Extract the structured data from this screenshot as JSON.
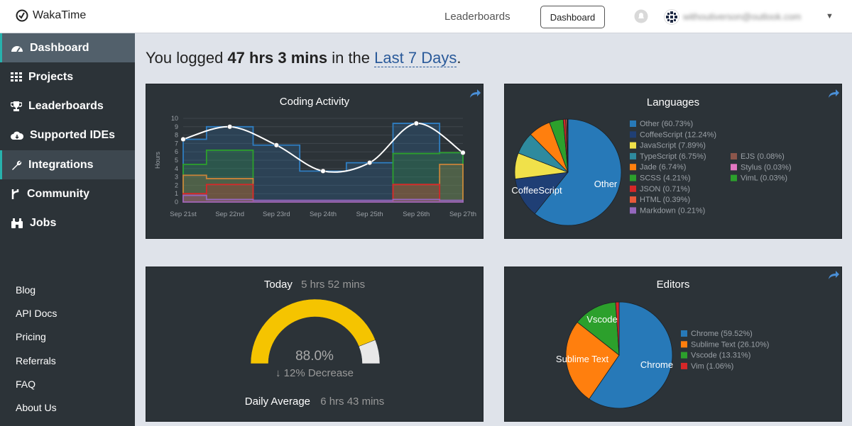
{
  "app": {
    "name": "WakaTime"
  },
  "topnav": {
    "leaderboards": "Leaderboards",
    "dashboard": "Dashboard",
    "email": "withoutiverson@outlook.com"
  },
  "sidebar": {
    "items": [
      {
        "label": "Dashboard",
        "icon": "dashboard-icon"
      },
      {
        "label": "Projects",
        "icon": "grid-icon"
      },
      {
        "label": "Leaderboards",
        "icon": "trophy-icon"
      },
      {
        "label": "Supported IDEs",
        "icon": "cloud-download-icon"
      },
      {
        "label": "Integrations",
        "icon": "wrench-icon"
      },
      {
        "label": "Community",
        "icon": "fork-icon"
      },
      {
        "label": "Jobs",
        "icon": "binoculars-icon"
      }
    ],
    "footer": [
      "Blog",
      "API Docs",
      "Pricing",
      "Referrals",
      "FAQ",
      "About Us"
    ]
  },
  "summary": {
    "prefix": "You logged",
    "total": "47 hrs 3 mins",
    "mid": "in the",
    "range": "Last 7 Days",
    "suffix": "."
  },
  "cards": {
    "coding": {
      "title": "Coding Activity"
    },
    "languages": {
      "title": "Languages"
    },
    "today": {
      "label": "Today",
      "value": "5 hrs 52 mins",
      "percent": "88.0%",
      "change": "12% Decrease",
      "avg_label": "Daily Average",
      "avg_value": "6 hrs 43 mins",
      "fill_fraction": 0.88
    },
    "editors": {
      "title": "Editors"
    }
  },
  "chart_data": [
    {
      "type": "line",
      "title": "Coding Activity",
      "ylabel": "Hours",
      "ylim": [
        0,
        10
      ],
      "yticks": [
        "0",
        "1",
        "2",
        "3",
        "4",
        "5",
        "6",
        "7",
        "8",
        "9",
        "10"
      ],
      "categories": [
        "Sep 21st",
        "Sep 22nd",
        "Sep 23rd",
        "Sep 24th",
        "Sep 25th",
        "Sep 26th",
        "Sep 27th"
      ],
      "series": [
        {
          "values": [
            7.5,
            9.0,
            6.8,
            3.7,
            4.7,
            9.4,
            5.9
          ],
          "color": "#ffffff"
        }
      ],
      "stacks": [
        {
          "values": [
            7.5,
            9.0,
            6.8,
            3.7,
            4.7,
            9.4,
            5.9
          ],
          "color": "#2f7dc0"
        },
        {
          "values": [
            4.5,
            6.2,
            0,
            0,
            0,
            5.8,
            5.9
          ],
          "color": "#2ca02c"
        },
        {
          "values": [
            3.2,
            2.8,
            0,
            0,
            0,
            2.1,
            4.5
          ],
          "color": "#c8833a"
        },
        {
          "values": [
            1.0,
            2.1,
            0,
            0,
            0,
            2.1,
            0
          ],
          "color": "#d62728"
        },
        {
          "values": [
            0.8,
            0.3,
            0.2,
            0.2,
            0.2,
            0.3,
            0.2
          ],
          "color": "#9467bd"
        }
      ]
    },
    {
      "type": "pie",
      "title": "Languages",
      "labels": [
        "Other",
        "CoffeeScript",
        "JavaScript",
        "TypeScript",
        "Jade",
        "SCSS",
        "JSON",
        "HTML",
        "Markdown",
        "EJS",
        "Stylus",
        "VimL"
      ],
      "legend": [
        "Other (60.73%)",
        "CoffeeScript (12.24%)",
        "JavaScript (7.89%)",
        "TypeScript (6.75%)",
        "Jade (6.74%)",
        "SCSS (4.21%)",
        "JSON (0.71%)",
        "HTML (0.39%)",
        "Markdown (0.21%)",
        "EJS (0.08%)",
        "Stylus (0.03%)",
        "VimL (0.03%)"
      ],
      "values": [
        60.73,
        12.24,
        7.89,
        6.75,
        6.74,
        4.21,
        0.71,
        0.39,
        0.21,
        0.08,
        0.03,
        0.03
      ],
      "colors": [
        "#2779b8",
        "#1f3f75",
        "#f0e14a",
        "#2e8a9e",
        "#ff7f0e",
        "#2ca02c",
        "#d62728",
        "#e8593a",
        "#9467bd",
        "#8c564b",
        "#e377c2",
        "#2ca02c"
      ],
      "slice_labels": [
        "Other",
        "CoffeeScript"
      ]
    },
    {
      "type": "pie",
      "title": "Editors",
      "labels": [
        "Chrome",
        "Sublime Text",
        "Vscode",
        "Vim"
      ],
      "legend": [
        "Chrome (59.52%)",
        "Sublime Text (26.10%)",
        "Vscode (13.31%)",
        "Vim (1.06%)"
      ],
      "values": [
        59.52,
        26.1,
        13.31,
        1.06
      ],
      "colors": [
        "#2779b8",
        "#ff7f0e",
        "#2ca02c",
        "#d62728"
      ],
      "slice_labels": [
        "Chrome",
        "Sublime Text",
        "Vscode"
      ]
    }
  ]
}
